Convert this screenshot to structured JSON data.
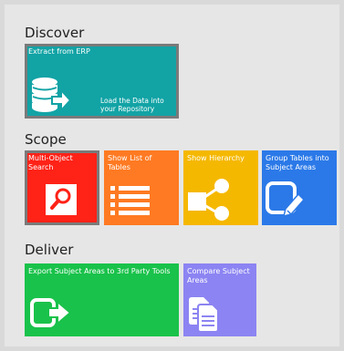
{
  "colors": {
    "teal": "#12a3a5",
    "red": "#ff2217",
    "orange": "#ff7a22",
    "yellow": "#f5b800",
    "blue": "#2b79e8",
    "green": "#19c24a",
    "lavender": "#8c84f2"
  },
  "sections": {
    "discover": "Discover",
    "scope": "Scope",
    "deliver": "Deliver"
  },
  "tiles": {
    "extract": {
      "label": "Extract from ERP",
      "sub": "Load the Data into your Repository",
      "icon": "database-import-icon"
    },
    "multi_object": {
      "label": "Multi-Object Search",
      "icon": "search-icon"
    },
    "show_list": {
      "label": "Show List of Tables",
      "icon": "list-icon"
    },
    "hierarchy": {
      "label": "Show Hierarchy",
      "icon": "hierarchy-icon"
    },
    "group_tables": {
      "label": "Group Tables into Subject Areas",
      "icon": "edit-icon"
    },
    "export": {
      "label": "Export Subject Areas to 3rd Party Tools",
      "icon": "export-icon"
    },
    "compare": {
      "label": "Compare Subject Areas",
      "icon": "compare-documents-icon"
    }
  }
}
